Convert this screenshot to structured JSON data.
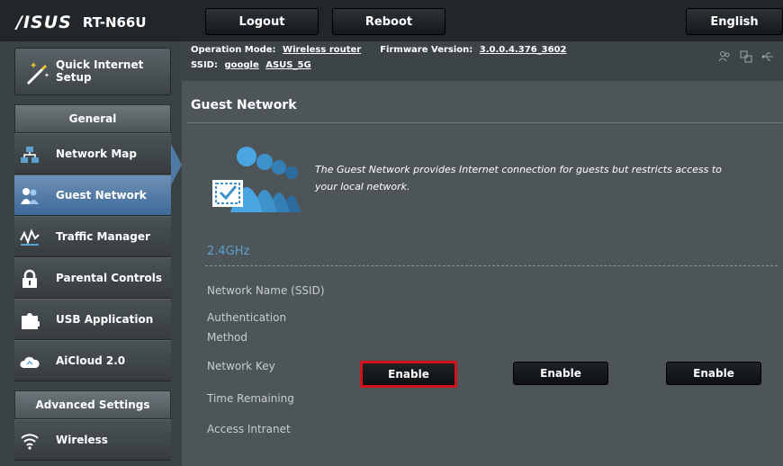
{
  "header": {
    "logo_brand": "/ISUS",
    "logo_model": "RT-N66U",
    "logout_label": "Logout",
    "reboot_label": "Reboot",
    "language_label": "English"
  },
  "info": {
    "op_mode_label": "Operation Mode:",
    "op_mode_value": "Wireless router",
    "firmware_label": "Firmware Version:",
    "firmware_value": "3.0.0.4.376_3602",
    "ssid_label": "SSID:",
    "ssid_value_1": "google",
    "ssid_value_2": "ASUS_5G"
  },
  "sidebar": {
    "quick_setup_label": "Quick Internet Setup",
    "general_label": "General",
    "items": [
      {
        "label": "Network Map",
        "icon": "network-map-icon"
      },
      {
        "label": "Guest Network",
        "icon": "guest-network-icon",
        "active": true
      },
      {
        "label": "Traffic Manager",
        "icon": "traffic-manager-icon"
      },
      {
        "label": "Parental Controls",
        "icon": "lock-icon"
      },
      {
        "label": "USB Application",
        "icon": "puzzle-icon"
      },
      {
        "label": "AiCloud 2.0",
        "icon": "cloud-icon"
      }
    ],
    "advanced_label": "Advanced Settings",
    "advanced_items": [
      {
        "label": "Wireless",
        "icon": "wireless-icon"
      }
    ]
  },
  "main": {
    "title": "Guest Network",
    "description": "The Guest Network provides Internet connection for guests but restricts access to your local network.",
    "band_label": "2.4GHz",
    "fields": {
      "ssid": "Network Name (SSID)",
      "auth": "Authentication Method",
      "key": "Network Key",
      "time": "Time Remaining",
      "intranet": "Access Intranet"
    },
    "enable_buttons": [
      "Enable",
      "Enable",
      "Enable"
    ]
  },
  "colors": {
    "accent": "#5ba0d0",
    "highlight": "#d4121c",
    "active_nav": "#4f7aa6"
  }
}
